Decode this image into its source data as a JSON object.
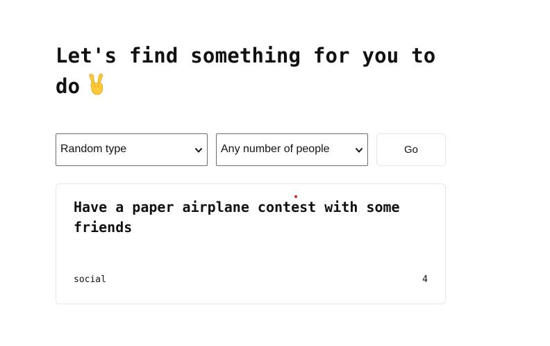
{
  "header": {
    "title": "Let's find something for you to do",
    "emoji_icon": "victory-hand-emoji"
  },
  "filters": {
    "type_select": {
      "selected": "Random type",
      "icon": "chevron-down-icon"
    },
    "people_select": {
      "selected": "Any number of people",
      "icon": "chevron-down-icon"
    },
    "go_label": "Go"
  },
  "activity": {
    "title": "Have a paper airplane contest with some friends",
    "type": "social",
    "participants": "4"
  },
  "colors": {
    "text": "#111111",
    "border": "#e6e6e6",
    "select_border": "#6b6b6b",
    "cursor": "#e02020"
  }
}
